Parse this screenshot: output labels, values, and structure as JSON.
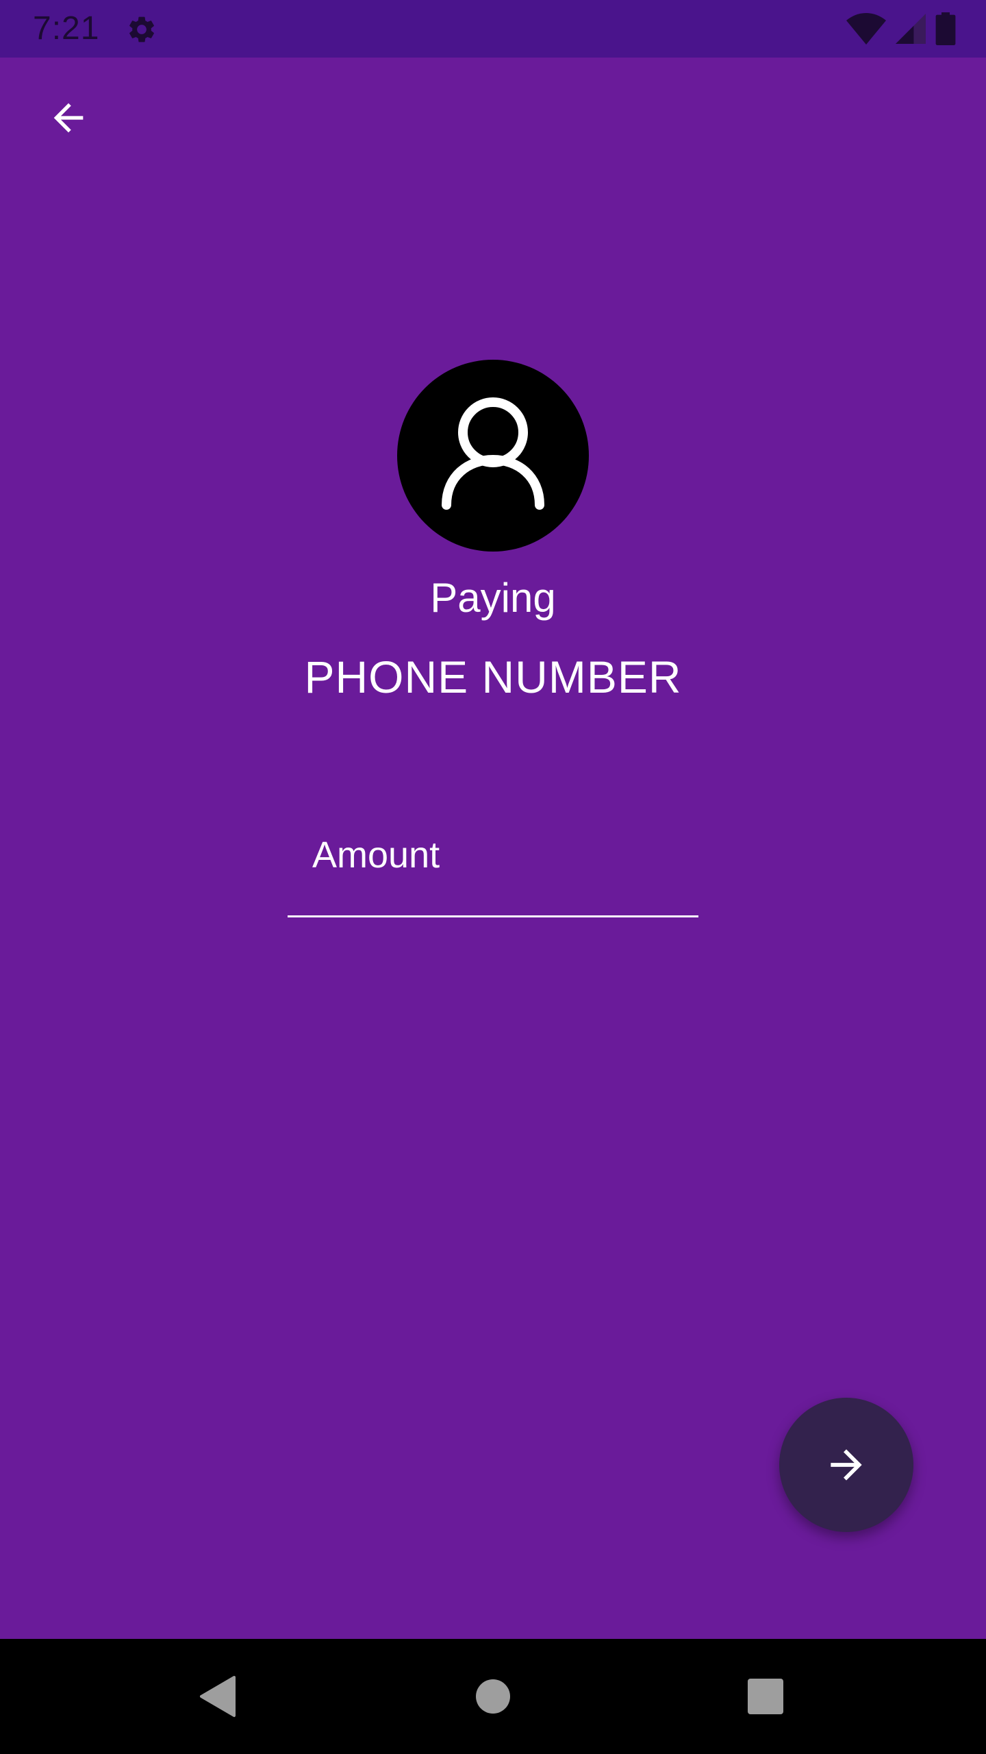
{
  "status_bar": {
    "time": "7:21",
    "icons": [
      "settings-gear-icon",
      "wifi-icon",
      "cellular-signal-icon",
      "battery-icon"
    ]
  },
  "header": {
    "back_icon": "arrow-back-icon"
  },
  "payee": {
    "avatar_icon": "person-outline-icon",
    "paying_label": "Paying",
    "recipient": "PHONE NUMBER"
  },
  "amount": {
    "placeholder": "Amount",
    "value": ""
  },
  "fab": {
    "icon": "arrow-forward-icon"
  },
  "nav_bar": {
    "icons": [
      "nav-back-icon",
      "nav-home-icon",
      "nav-recents-icon"
    ]
  },
  "colors": {
    "status_bar": "#4a148c",
    "background": "#6a1b9a",
    "fab": "#33224d",
    "nav_bar": "#000000",
    "text": "#ffffff"
  }
}
